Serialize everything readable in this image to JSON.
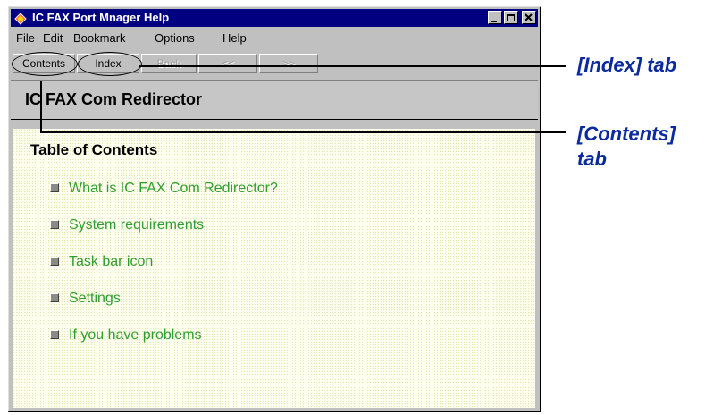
{
  "window": {
    "title": "IC FAX Port Mnager Help"
  },
  "menubar": [
    "File",
    "Edit",
    "Bookmark",
    "Options",
    "Help"
  ],
  "toolbar": {
    "contents": "Contents",
    "index": "Index",
    "back": "Back",
    "prev": "<<",
    "next": ">>"
  },
  "topic": {
    "title": "IC FAX Com Redirector"
  },
  "toc": {
    "heading": "Table of Contents",
    "items": [
      "What is IC FAX Com Redirector?",
      "System requirements",
      "Task bar icon",
      "Settings",
      "If you have problems"
    ]
  },
  "callouts": {
    "index": "[Index] tab",
    "contents_line1": "[Contents]",
    "contents_line2": "tab"
  },
  "colors": {
    "titlebar": "#000080",
    "link": "#2e9e2e",
    "callout": "#0a2a9e",
    "content_bg": "#fffff0"
  }
}
